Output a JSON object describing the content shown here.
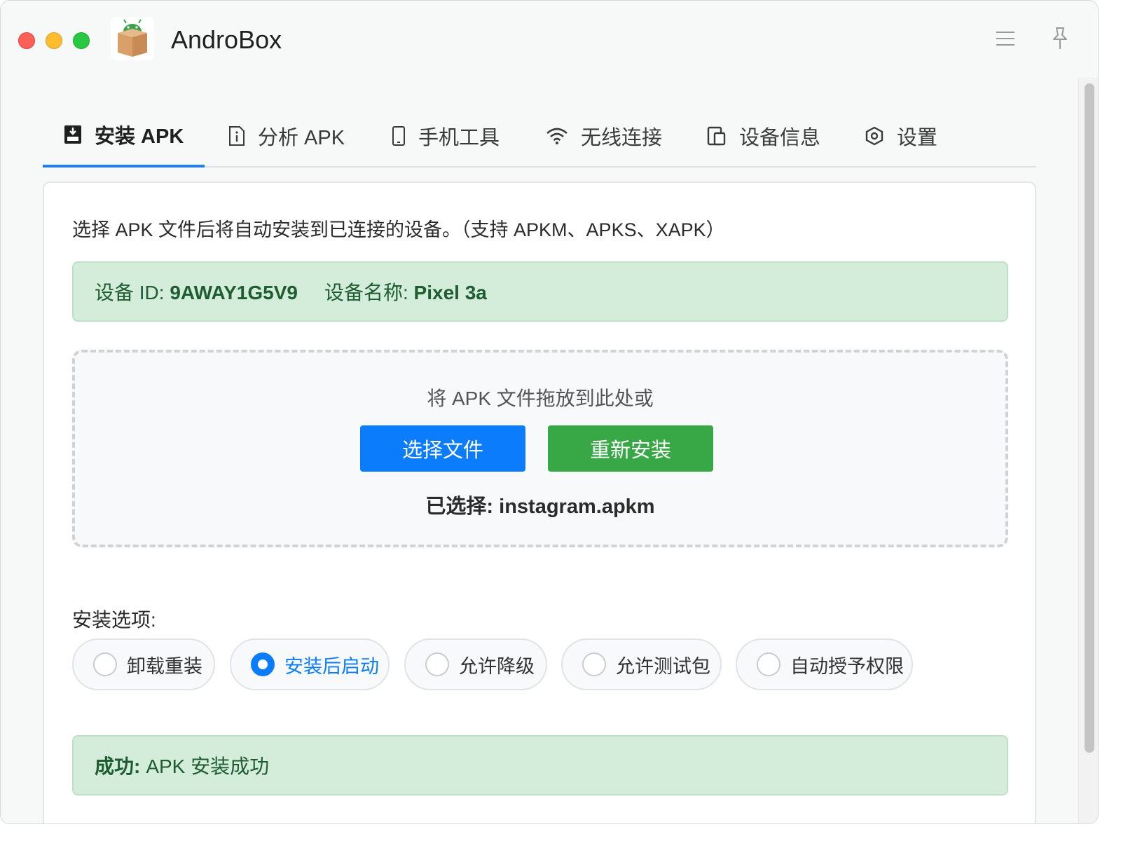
{
  "window": {
    "title": "AndroBox"
  },
  "titlebar": {
    "menu_icon": "hamburger-icon",
    "pin_icon": "pin-icon"
  },
  "tabs": [
    {
      "label": "安装 APK",
      "icon": "install-icon",
      "active": true
    },
    {
      "label": "分析 APK",
      "icon": "info-doc-icon",
      "active": false
    },
    {
      "label": "手机工具",
      "icon": "phone-icon",
      "active": false
    },
    {
      "label": "无线连接",
      "icon": "wifi-icon",
      "active": false
    },
    {
      "label": "设备信息",
      "icon": "devices-icon",
      "active": false
    },
    {
      "label": "设置",
      "icon": "settings-icon",
      "active": false
    }
  ],
  "install": {
    "description": "选择 APK 文件后将自动安装到已连接的设备。（支持 APKM、APKS、XAPK）",
    "device": {
      "id_label": "设备 ID:",
      "id_value": "9AWAY1G5V9",
      "name_label": "设备名称:",
      "name_value": "Pixel 3a"
    },
    "dropzone": {
      "hint": "将 APK 文件拖放到此处或",
      "choose_button": "选择文件",
      "reinstall_button": "重新安装",
      "selected_label": "已选择:",
      "selected_file": "instagram.apkm"
    },
    "options_label": "安装选项:",
    "options": [
      {
        "label": "卸载重装",
        "checked": false
      },
      {
        "label": "安装后启动",
        "checked": true
      },
      {
        "label": "允许降级",
        "checked": false
      },
      {
        "label": "允许测试包",
        "checked": false
      },
      {
        "label": "自动授予权限",
        "checked": false
      }
    ],
    "result": {
      "prefix": "成功:",
      "message": "APK 安装成功"
    }
  },
  "colors": {
    "accent": "#0b7cfb",
    "reinstall": "#37a845",
    "success_bg": "#d4ecda",
    "success_text": "#1e5c31"
  }
}
